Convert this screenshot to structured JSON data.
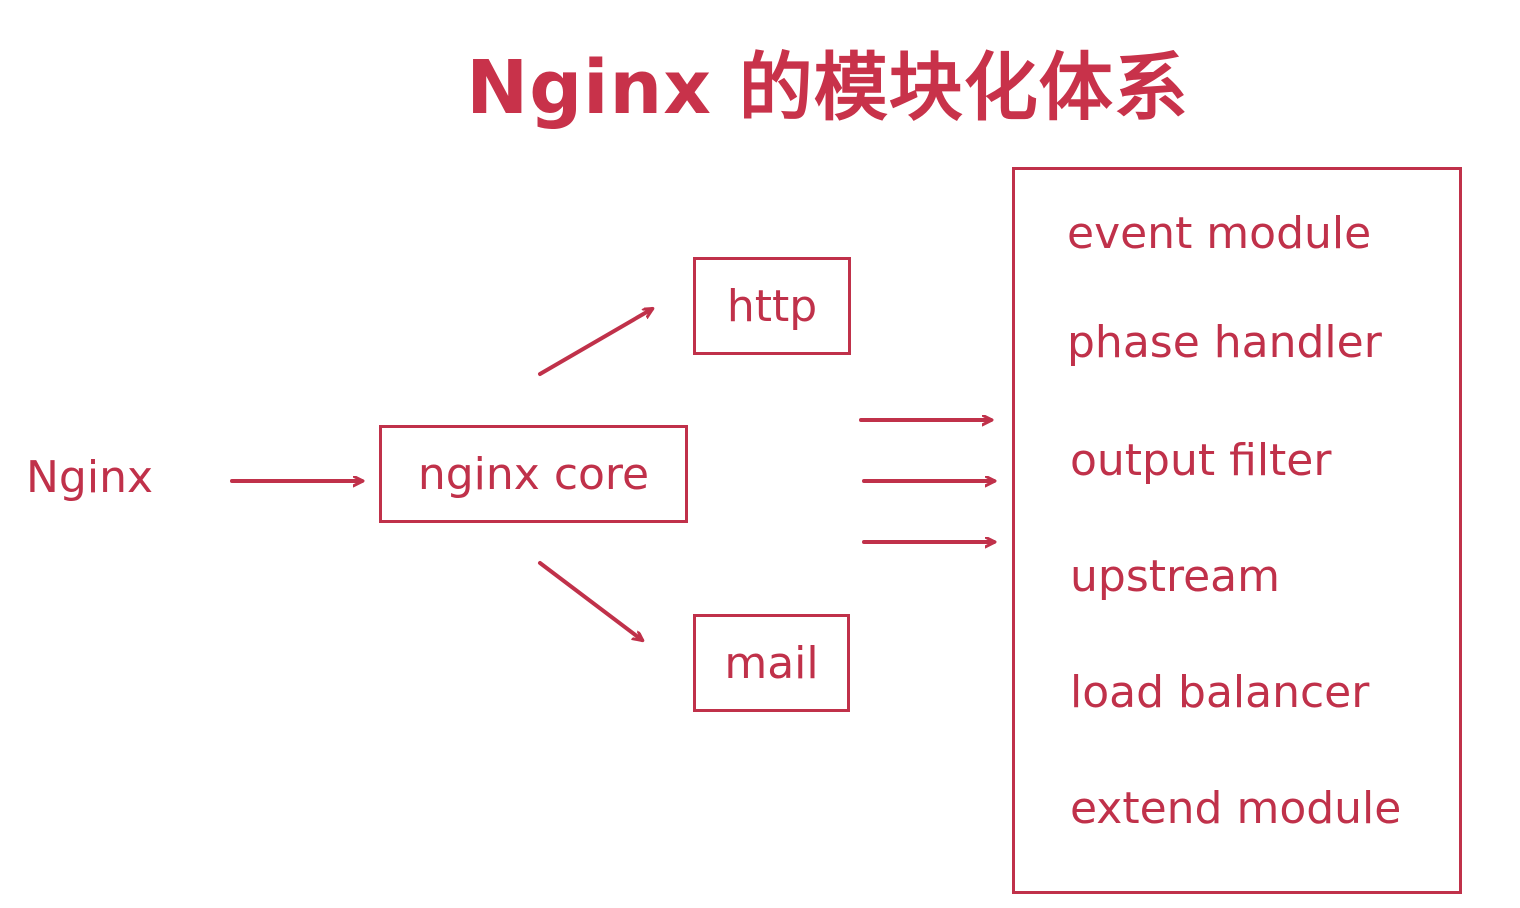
{
  "title": "Nginx 的模块化体系",
  "root_label": "Nginx",
  "core": "nginx core",
  "branches": [
    "http",
    "mail"
  ],
  "modules": [
    "event module",
    "phase handler",
    "output filter",
    "upstream",
    "load balancer",
    "extend module"
  ],
  "colors": {
    "accent": "#c0314a",
    "title": "#c8324a",
    "background": "#ffffff"
  }
}
